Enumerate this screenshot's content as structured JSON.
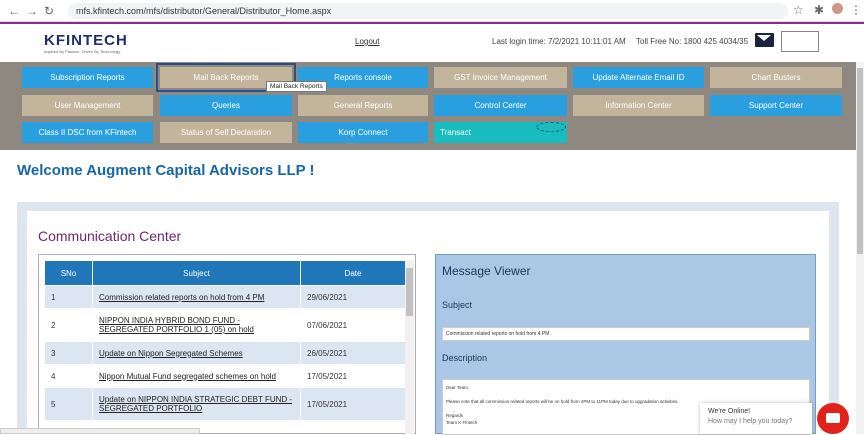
{
  "browser": {
    "url": "mfs.kfintech.com/mfs/distributor/General/Distributor_Home.aspx"
  },
  "header": {
    "logo": "KFINTECH",
    "tagline": "Inspired By Passion. Driven By Technology.",
    "logout": "Logout",
    "last_login": "Last login time: 7/2/2021 10:11:01 AM",
    "toll_free": "Toll Free No: 1800 425 4034/35"
  },
  "menu": {
    "subscription": "Subscription Reports",
    "mailback": "Mail Back Reports",
    "reports_console": "Reports console",
    "gst": "GST Invoice Management",
    "alt_email": "Update Alternate Email ID",
    "chart": "Chart Busters",
    "user_mgmt": "User Management",
    "queries": "Queries",
    "general": "General Reports",
    "control": "Control Center",
    "info": "Information Center",
    "support": "Support Center",
    "dsc": "Class II DSC from KFintech",
    "self_decl": "Status of Self Declaration",
    "korp": "Korp Connect",
    "transact": "Transact",
    "tooltip": "Mail Back Reports"
  },
  "welcome": "Welcome Augment Capital Advisors LLP !",
  "comm": {
    "title": "Communication Center",
    "headers": {
      "sno": "SNo",
      "subject": "Subject",
      "date": "Date"
    },
    "rows": [
      {
        "sno": "1",
        "subject": "Commission related reports on hold from 4 PM",
        "date": "29/06/2021"
      },
      {
        "sno": "2",
        "subject": "NIPPON INDIA HYBRID BOND FUND - SEGREGATED PORTFOLIO 1 (05) on hold",
        "date": "07/06/2021"
      },
      {
        "sno": "3",
        "subject": "Update on Nippon Segregated Schemes",
        "date": "26/05/2021"
      },
      {
        "sno": "4",
        "subject": "Nippon Mutual Fund segregated schemes on hold",
        "date": "17/05/2021"
      },
      {
        "sno": "5",
        "subject": "Update on NIPPON INDIA STRATEGIC DEBT FUND - SEGREGATED PORTFOLIO",
        "date": "17/05/2021"
      }
    ]
  },
  "viewer": {
    "title": "Message Viewer",
    "subject_label": "Subject",
    "subject": "Commission related reports on hold from 4 PM",
    "desc_label": "Description",
    "desc1": "Dear Team,",
    "desc2": "Please note that all commission related reports will be on hold from 4PM to 11PM today due to upgradation activities.",
    "desc3": "Regards",
    "desc4": "Team K Fintech"
  },
  "chat": {
    "title": "We're Online!",
    "sub": "How may I help you today?"
  }
}
